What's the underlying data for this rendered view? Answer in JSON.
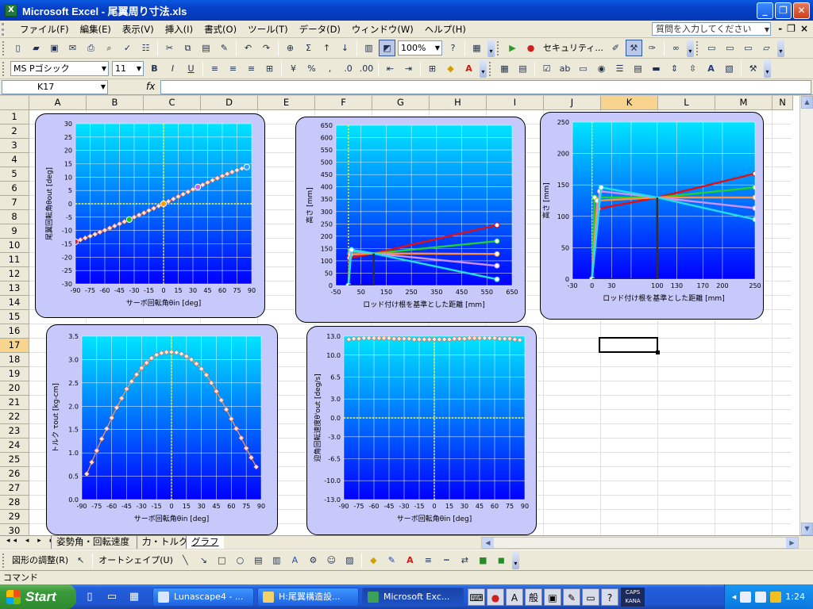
{
  "window": {
    "title": "Microsoft Excel - 尾翼周り寸法.xls",
    "app_icon": "X"
  },
  "menubar": {
    "items": [
      "ファイル(F)",
      "編集(E)",
      "表示(V)",
      "挿入(I)",
      "書式(O)",
      "ツール(T)",
      "データ(D)",
      "ウィンドウ(W)",
      "ヘルプ(H)"
    ],
    "help_placeholder": "質問を入力してください"
  },
  "toolbar1": {
    "zoom": "100%",
    "security_label": "セキュリティ..."
  },
  "toolbar2": {
    "font_name": "MS Pゴシック",
    "font_size": "11"
  },
  "formulabar": {
    "cell_ref": "K17",
    "fx": "fx",
    "value": ""
  },
  "columns": [
    "A",
    "B",
    "C",
    "D",
    "E",
    "F",
    "G",
    "H",
    "I",
    "J",
    "K",
    "L",
    "M",
    "N"
  ],
  "rows": [
    "1",
    "2",
    "3",
    "4",
    "5",
    "6",
    "7",
    "8",
    "9",
    "10",
    "11",
    "12",
    "13",
    "14",
    "15",
    "16",
    "17",
    "18",
    "19",
    "20",
    "21",
    "22",
    "23",
    "24",
    "25",
    "26",
    "27",
    "28",
    "29",
    "30"
  ],
  "selected_column": "K",
  "selected_row": "17",
  "sheet_tabs": [
    {
      "label": "姿勢角・回転速度",
      "active": false
    },
    {
      "label": "力・トルク",
      "active": false
    },
    {
      "label": "グラフ",
      "active": true
    }
  ],
  "drawbar": {
    "adjust_label": "図形の調整(R)",
    "autoshape_label": "オートシェイプ(U)"
  },
  "statusbar": {
    "text": "コマンド"
  },
  "taskbar": {
    "start_label": "Start",
    "tasks": [
      {
        "label": "Lunascape4 - ...",
        "active": false
      },
      {
        "label": "H:尾翼構造設...",
        "active": false
      },
      {
        "label": "Microsoft Exc...",
        "active": true
      }
    ],
    "ime": {
      "mode1": "A",
      "mode2": "般",
      "caps": "CAPS",
      "kana": "KANA"
    },
    "clock": "1:24"
  },
  "colors": {
    "plot_top": "#00e5ff",
    "plot_bottom": "#0000ff",
    "chart_bg": "#c7c9fb",
    "marker": "#ffe8e0"
  },
  "chart_data": [
    {
      "type": "scatter",
      "name": "servo-vs-tail-angle",
      "xlabel": "サーボ回転角θin [deg]",
      "ylabel": "尾翼回転角θout [deg]",
      "xlim": [
        -90,
        90
      ],
      "ylim": [
        -30,
        30
      ],
      "xticks": [
        -90,
        -75,
        -60,
        -45,
        -30,
        -15,
        0,
        15,
        30,
        45,
        60,
        75,
        90
      ],
      "yticks": [
        30,
        25,
        20,
        15,
        10,
        5,
        0,
        -5,
        -10,
        -15,
        -20,
        -25,
        -30
      ],
      "series": [
        {
          "x": [
            -90,
            -85,
            -80,
            -75,
            -70,
            -65,
            -60,
            -55,
            -50,
            -45,
            -40,
            -35,
            -30,
            -25,
            -20,
            -15,
            -10,
            -5,
            0,
            5,
            10,
            15,
            20,
            25,
            30,
            35,
            40,
            45,
            50,
            55,
            60,
            65,
            70,
            75,
            80,
            85
          ],
          "y": [
            -14.2,
            -13.5,
            -12.8,
            -12.1,
            -11.4,
            -10.6,
            -9.9,
            -9.1,
            -8.3,
            -7.5,
            -6.7,
            -5.9,
            -5.0,
            -4.2,
            -3.4,
            -2.5,
            -1.7,
            -0.8,
            0,
            0.9,
            1.8,
            2.7,
            3.6,
            4.5,
            5.4,
            6.3,
            7.1,
            8.0,
            8.8,
            9.6,
            10.4,
            11.2,
            11.9,
            12.6,
            13.2,
            13.8
          ]
        }
      ],
      "highlights": [
        {
          "x": -90,
          "y": -14.2,
          "color": "#ff1030"
        },
        {
          "x": -35,
          "y": -5.9,
          "color": "#20c020"
        },
        {
          "x": 0,
          "y": 0,
          "color": "#ffa000"
        },
        {
          "x": 35,
          "y": 6.3,
          "color": "#c060ff"
        },
        {
          "x": 85,
          "y": 13.8,
          "color": "#30a0ff"
        }
      ]
    },
    {
      "type": "line",
      "name": "linkage-geometry-wide",
      "xlabel": "ロッド付け根を基準とした距離 [mm]",
      "ylabel": "高さ [mm]",
      "xlim": [
        -50,
        650
      ],
      "ylim": [
        0,
        650
      ],
      "xticks": [
        -50,
        50,
        150,
        250,
        350,
        450,
        550,
        650
      ],
      "yticks": [
        650,
        600,
        550,
        500,
        450,
        400,
        350,
        300,
        250,
        200,
        150,
        100,
        50,
        0
      ],
      "series": [
        {
          "color": "#e01010",
          "x": [
            0,
            4,
            100,
            590
          ],
          "y": [
            0,
            112,
            130,
            245
          ]
        },
        {
          "color": "#20d030",
          "x": [
            0,
            6,
            100,
            590
          ],
          "y": [
            0,
            130,
            130,
            180
          ]
        },
        {
          "color": "#ff9040",
          "x": [
            0,
            8,
            100,
            590
          ],
          "y": [
            0,
            125,
            130,
            128
          ]
        },
        {
          "color": "#d090ff",
          "x": [
            0,
            10,
            100,
            590
          ],
          "y": [
            0,
            140,
            130,
            80
          ]
        },
        {
          "color": "#20e0e0",
          "x": [
            0,
            12,
            100,
            590
          ],
          "y": [
            0,
            145,
            130,
            25
          ]
        },
        {
          "color": "#303030",
          "x": [
            0,
            0,
            100,
            100
          ],
          "y": [
            0,
            0,
            0,
            130
          ]
        }
      ]
    },
    {
      "type": "line",
      "name": "linkage-geometry-zoom",
      "xlabel": "ロッド付け根を基準とした距離 [mm]",
      "ylabel": "高さ [mm]",
      "xlim": [
        -30,
        250
      ],
      "ylim": [
        0,
        250
      ],
      "xticks": [
        -30,
        0,
        30,
        60,
        100,
        130,
        170,
        200,
        250
      ],
      "xtick_labels": [
        "-30",
        "0",
        "30",
        "",
        "100",
        "130",
        "170",
        "200",
        "250"
      ],
      "yticks": [
        250,
        200,
        150,
        100,
        50,
        0
      ],
      "series": [
        {
          "color": "#e01010",
          "x": [
            0,
            10,
            100,
            250
          ],
          "y": [
            0,
            112,
            130,
            168
          ]
        },
        {
          "color": "#20d030",
          "x": [
            0,
            4,
            100,
            250
          ],
          "y": [
            0,
            130,
            130,
            146
          ]
        },
        {
          "color": "#ff9040",
          "x": [
            0,
            8,
            100,
            250
          ],
          "y": [
            0,
            125,
            130,
            130
          ]
        },
        {
          "color": "#d090ff",
          "x": [
            0,
            12,
            100,
            250
          ],
          "y": [
            0,
            140,
            130,
            113
          ]
        },
        {
          "color": "#20e0e0",
          "x": [
            0,
            14,
            100,
            250
          ],
          "y": [
            0,
            146,
            130,
            95
          ]
        },
        {
          "color": "#303030",
          "x": [
            0,
            0,
            100,
            100
          ],
          "y": [
            0,
            0,
            0,
            130
          ]
        }
      ]
    },
    {
      "type": "scatter",
      "name": "torque",
      "xlabel": "サーボ回転角θin [deg]",
      "ylabel": "トルク τout [kg-cm]",
      "xlim": [
        -90,
        90
      ],
      "ylim": [
        0,
        3.5
      ],
      "xticks": [
        -90,
        -75,
        -60,
        -45,
        -30,
        -15,
        0,
        15,
        30,
        45,
        60,
        75,
        90
      ],
      "yticks": [
        3.5,
        3.0,
        2.5,
        2.0,
        1.5,
        1.0,
        0.5,
        0.0
      ],
      "series": [
        {
          "x": [
            -85,
            -80,
            -75,
            -70,
            -65,
            -60,
            -55,
            -50,
            -45,
            -40,
            -35,
            -30,
            -25,
            -20,
            -15,
            -10,
            -5,
            0,
            5,
            10,
            15,
            20,
            25,
            30,
            35,
            40,
            45,
            50,
            55,
            60,
            65,
            70,
            75,
            80,
            85
          ],
          "y": [
            0.55,
            0.8,
            1.05,
            1.3,
            1.52,
            1.75,
            1.97,
            2.17,
            2.37,
            2.53,
            2.68,
            2.82,
            2.93,
            3.03,
            3.1,
            3.14,
            3.16,
            3.16,
            3.15,
            3.12,
            3.07,
            3.0,
            2.91,
            2.8,
            2.67,
            2.5,
            2.32,
            2.13,
            1.93,
            1.73,
            1.52,
            1.32,
            1.1,
            0.9,
            0.7
          ]
        }
      ]
    },
    {
      "type": "scatter",
      "name": "angular-velocity",
      "xlabel": "サーボ回転角θin [deg]",
      "ylabel": "迎角回転速度θ'out [deg/s]",
      "xlim": [
        -90,
        90
      ],
      "ylim": [
        -13,
        13
      ],
      "xticks": [
        -90,
        -75,
        -60,
        -45,
        -30,
        -15,
        0,
        15,
        30,
        45,
        60,
        75,
        90
      ],
      "yticks": [
        13.0,
        10.0,
        6.5,
        3.0,
        0.0,
        -3.0,
        -6.5,
        -10.0,
        -13.0
      ],
      "series": [
        {
          "x": [
            -85,
            -80,
            -75,
            -70,
            -65,
            -60,
            -55,
            -50,
            -45,
            -40,
            -35,
            -30,
            -25,
            -20,
            -15,
            -10,
            -5,
            0,
            5,
            10,
            15,
            20,
            25,
            30,
            35,
            40,
            45,
            50,
            55,
            60,
            65,
            70,
            75,
            80,
            85
          ],
          "y": [
            12.5,
            12.6,
            12.6,
            12.7,
            12.7,
            12.7,
            12.7,
            12.7,
            12.7,
            12.6,
            12.6,
            12.6,
            12.6,
            12.5,
            12.5,
            12.5,
            12.5,
            12.5,
            12.5,
            12.5,
            12.5,
            12.6,
            12.6,
            12.6,
            12.7,
            12.7,
            12.7,
            12.7,
            12.7,
            12.7,
            12.6,
            12.6,
            12.6,
            12.5,
            12.4
          ]
        }
      ]
    }
  ]
}
